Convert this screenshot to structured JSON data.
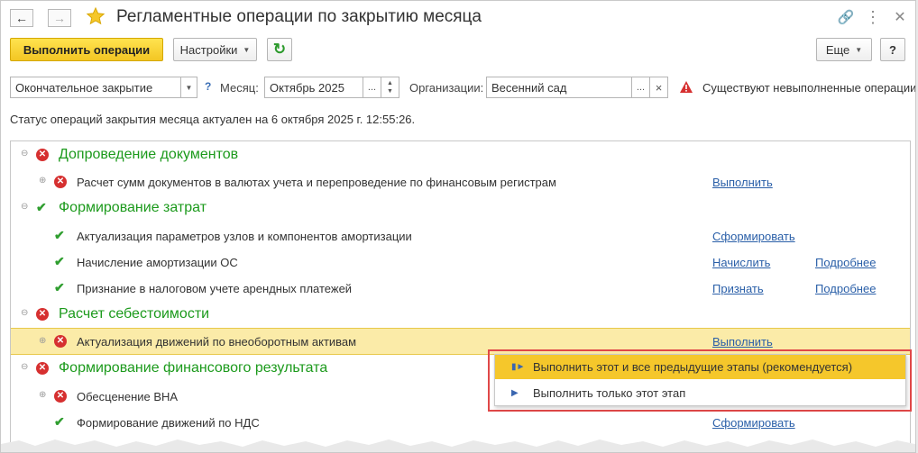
{
  "window": {
    "title": "Регламентные операции по закрытию месяца",
    "back_icon": "arrow-left-icon",
    "forward_icon": "arrow-right-icon",
    "favorite_icon": "star-icon",
    "link_icon": "link-icon",
    "more_icon": "kebab-icon",
    "close_icon": "close-icon"
  },
  "toolbar": {
    "execute_label": "Выполнить операции",
    "settings_label": "Настройки",
    "refresh_icon": "refresh-icon",
    "more_label": "Еще",
    "help_label": "?"
  },
  "filters": {
    "mode_value": "Окончательное закрытие",
    "help_mark": "?",
    "month_label": "Месяц:",
    "month_value": "Октябрь 2025",
    "month_pick": "...",
    "org_label": "Организации:",
    "org_value": "Весенний сад",
    "org_pick": "...",
    "org_clear": "×",
    "warning_text": "Существуют невыполненные операции",
    "warning_icon": "warning-triangle-icon"
  },
  "status_text": "Статус операций закрытия месяца актуален на 6 октября 2025 г. 12:55:26.",
  "groups": [
    {
      "title": "Допроведение документов",
      "state": "error"
    },
    {
      "title": "Формирование затрат",
      "state": "ok"
    },
    {
      "title": "Расчет себестоимости",
      "state": "error"
    },
    {
      "title": "Формирование финансового результата",
      "state": "error"
    }
  ],
  "items": [
    {
      "text": "Расчет сумм документов в валютах учета и перепроведение по финансовым регистрам",
      "action": "Выполнить",
      "details": ""
    },
    {
      "text": "Актуализация параметров узлов и компонентов амортизации",
      "action": "Сформировать",
      "details": ""
    },
    {
      "text": "Начисление амортизации ОС",
      "action": "Начислить",
      "details": "Подробнее"
    },
    {
      "text": "Признание в налоговом учете арендных платежей",
      "action": "Признать",
      "details": "Подробнее"
    },
    {
      "text": "Актуализация движений по внеоборотным активам",
      "action": "Выполнить",
      "details": ""
    },
    {
      "text": "Обесценение ВНА",
      "action": "",
      "details": ""
    },
    {
      "text": "Формирование движений по НДС",
      "action": "Сформировать",
      "details": ""
    }
  ],
  "popup": {
    "item1": "Выполнить этот и все предыдущие этапы (рекомендуется)",
    "item2": "Выполнить только этот этап"
  },
  "colors": {
    "accent_yellow": "#f5c72b",
    "group_green": "#1c9a1c",
    "error_red": "#d63030",
    "link_blue": "#2a5fa8",
    "selection": "#fbeba8"
  }
}
